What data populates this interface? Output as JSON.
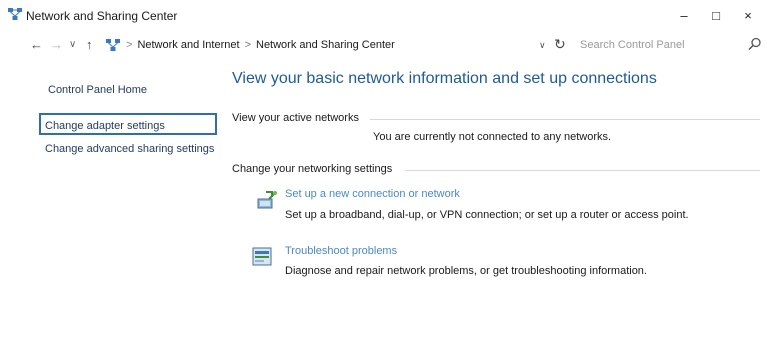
{
  "window": {
    "title": "Network and Sharing Center",
    "controls": {
      "minimize": "–",
      "maximize": "□",
      "close": "×"
    }
  },
  "navigation": {
    "back": "←",
    "forward": "→",
    "recent": "∨",
    "up": "↑"
  },
  "address": {
    "breadcrumbs": [
      "Network and Internet",
      "Network and Sharing Center"
    ],
    "separator": ">",
    "dropdown": "∨",
    "refresh": "↻"
  },
  "search": {
    "placeholder": "Search Control Panel"
  },
  "sidebar": {
    "items": [
      {
        "label": "Control Panel Home"
      },
      {
        "label": "Change adapter settings",
        "selected": true
      },
      {
        "label": "Change advanced sharing settings"
      }
    ]
  },
  "main": {
    "title": "View your basic network information and set up connections",
    "active_networks": {
      "heading": "View your active networks",
      "status": "You are currently not connected to any networks."
    },
    "settings": {
      "heading": "Change your networking settings",
      "tasks": [
        {
          "icon": "new-connection-icon",
          "label": "Set up a new connection or network",
          "description": "Set up a broadband, dial-up, or VPN connection; or set up a router or access point."
        },
        {
          "icon": "troubleshoot-icon",
          "label": "Troubleshoot problems",
          "description": "Diagnose and repair network problems, or get troubleshooting information."
        }
      ]
    }
  },
  "colors": {
    "title_blue": "#1e5a99",
    "link_blue": "#4a8ac4",
    "nav_text": "#1f3a5f",
    "selection_border": "#2d6fa8"
  }
}
